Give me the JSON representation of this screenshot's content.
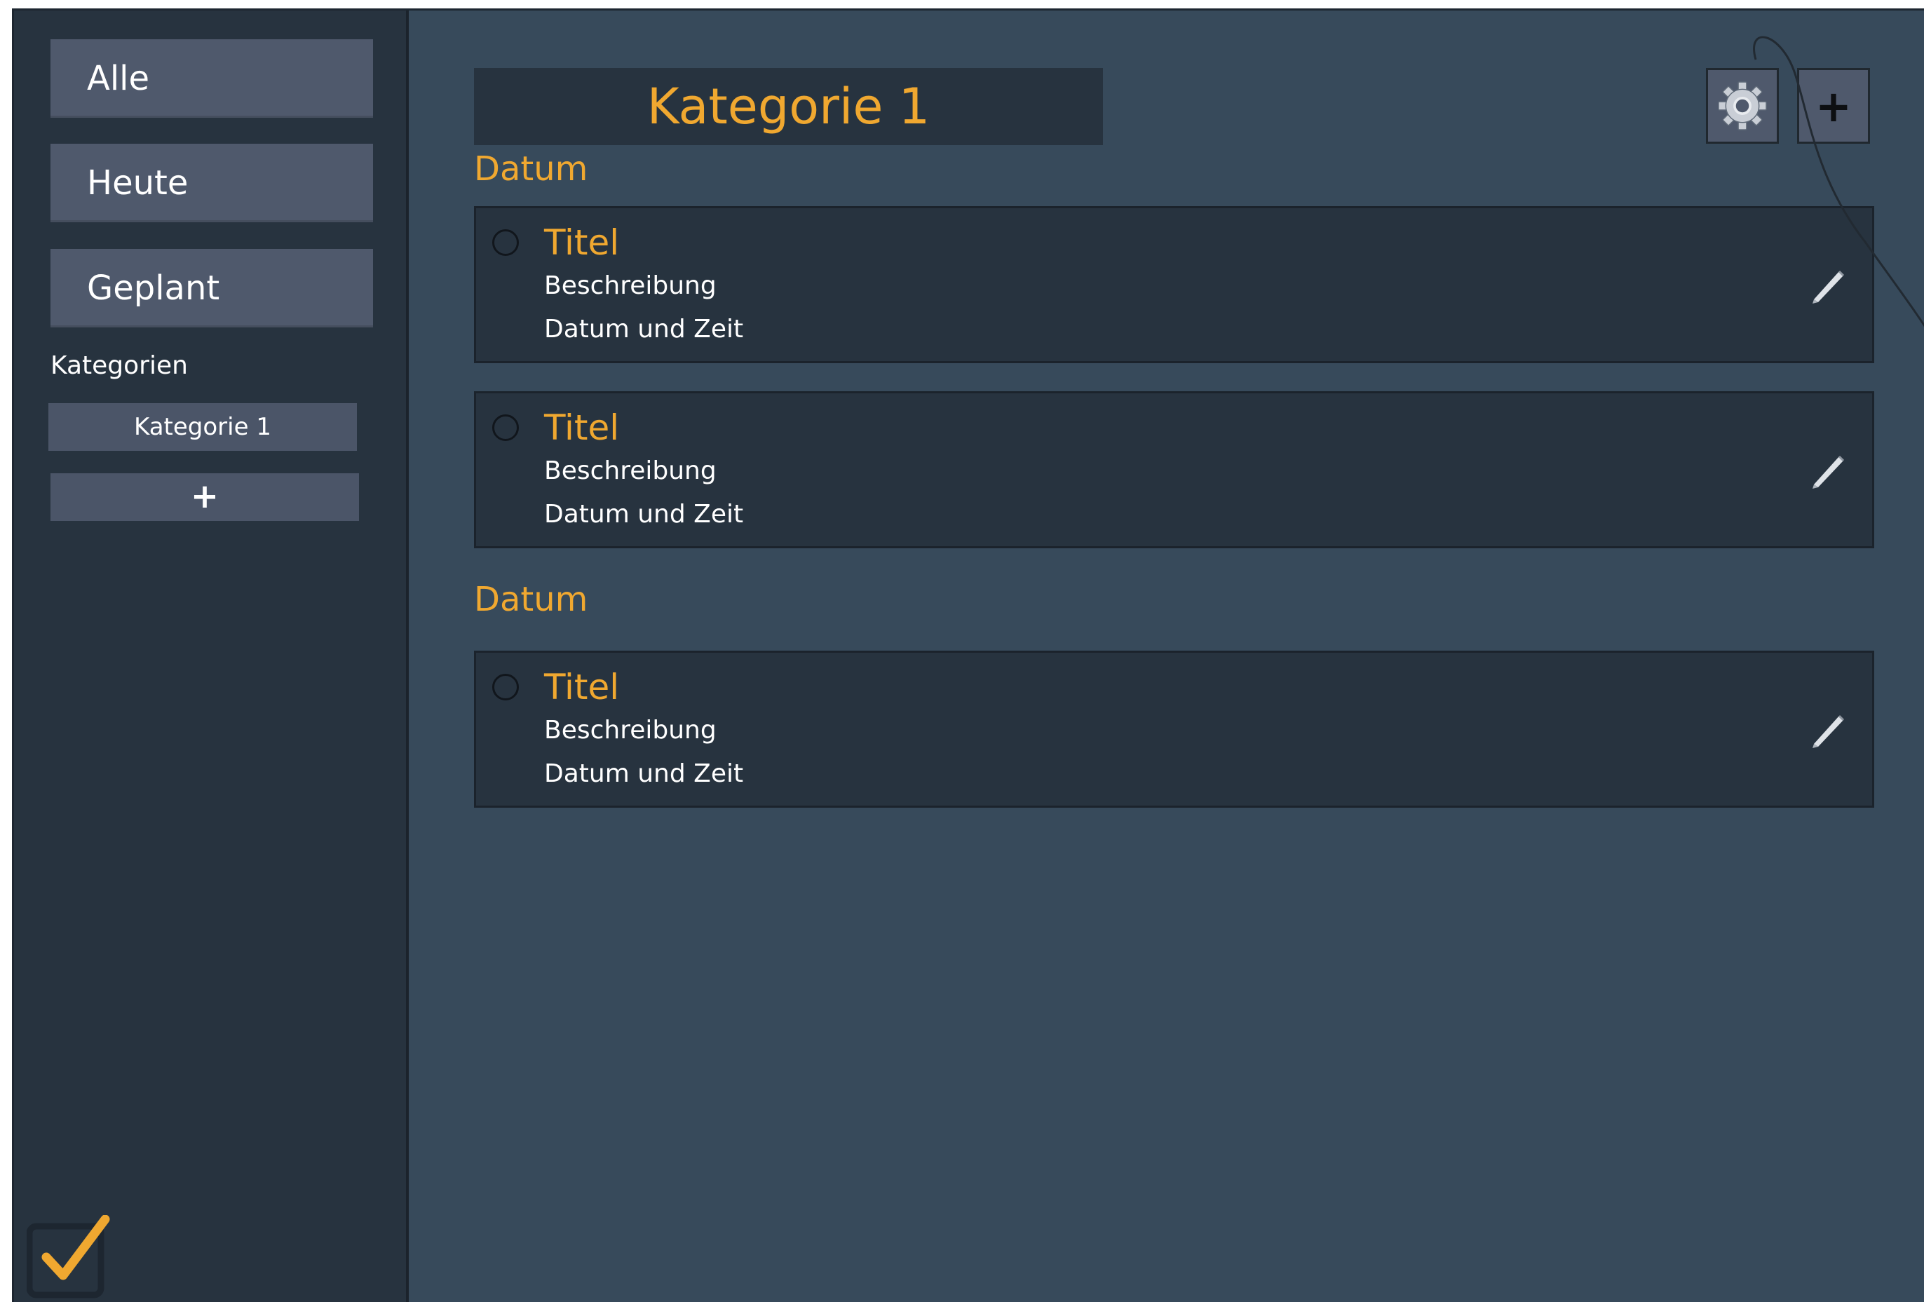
{
  "sidebar": {
    "nav": [
      {
        "label": "Alle"
      },
      {
        "label": "Heute"
      },
      {
        "label": "Geplant"
      }
    ],
    "categories_heading": "Kategorien",
    "categories": [
      {
        "label": "Kategorie 1"
      }
    ],
    "add_category_label": "+",
    "logo_icon": "check-square-logo-icon"
  },
  "main": {
    "title": "Kategorie 1",
    "settings_icon": "gear-icon",
    "add_label": "+",
    "groups": [
      {
        "heading": "Datum",
        "tasks": [
          {
            "title": "Titel",
            "description": "Beschreibung",
            "datetime": "Datum und Zeit"
          },
          {
            "title": "Titel",
            "description": "Beschreibung",
            "datetime": "Datum und Zeit"
          }
        ]
      },
      {
        "heading": "Datum",
        "tasks": [
          {
            "title": "Titel",
            "description": "Beschreibung",
            "datetime": "Datum und Zeit"
          }
        ]
      }
    ]
  },
  "colors": {
    "accent": "#f0a830",
    "background": "#374a5b",
    "sidebar": "#27333f",
    "button": "#4f596c"
  }
}
